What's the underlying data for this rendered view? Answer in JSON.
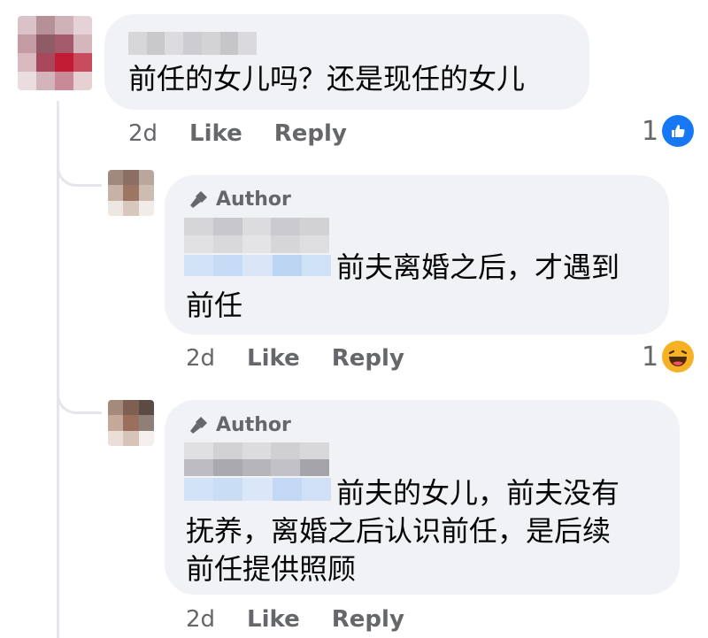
{
  "comments": [
    {
      "text_lines": [
        "前任的女儿吗？还是现任的女儿"
      ],
      "time": "2d",
      "like_label": "Like",
      "reply_label": "Reply",
      "reaction_count": "1",
      "reaction_icon": "like-icon",
      "reaction_color": "#1877f2"
    }
  ],
  "replies": [
    {
      "badge_label": "Author",
      "text_first": "前夫离婚之后，才遇到",
      "text_lines": [
        "前任"
      ],
      "time": "2d",
      "like_label": "Like",
      "reply_label": "Reply",
      "reaction_count": "1",
      "reaction_icon": "haha-icon"
    },
    {
      "badge_label": "Author",
      "text_first": "前夫的女儿，前夫没有",
      "text_lines": [
        "抚养，离婚之后认识前任，是后续",
        "前任提供照顾"
      ],
      "time": "2d",
      "like_label": "Like",
      "reply_label": "Reply"
    }
  ],
  "colors": {
    "bubble": "#f0f2f5",
    "secondary_text": "#65676b",
    "like_blue": "#1877f2",
    "haha_yellow": "#f7b125"
  }
}
